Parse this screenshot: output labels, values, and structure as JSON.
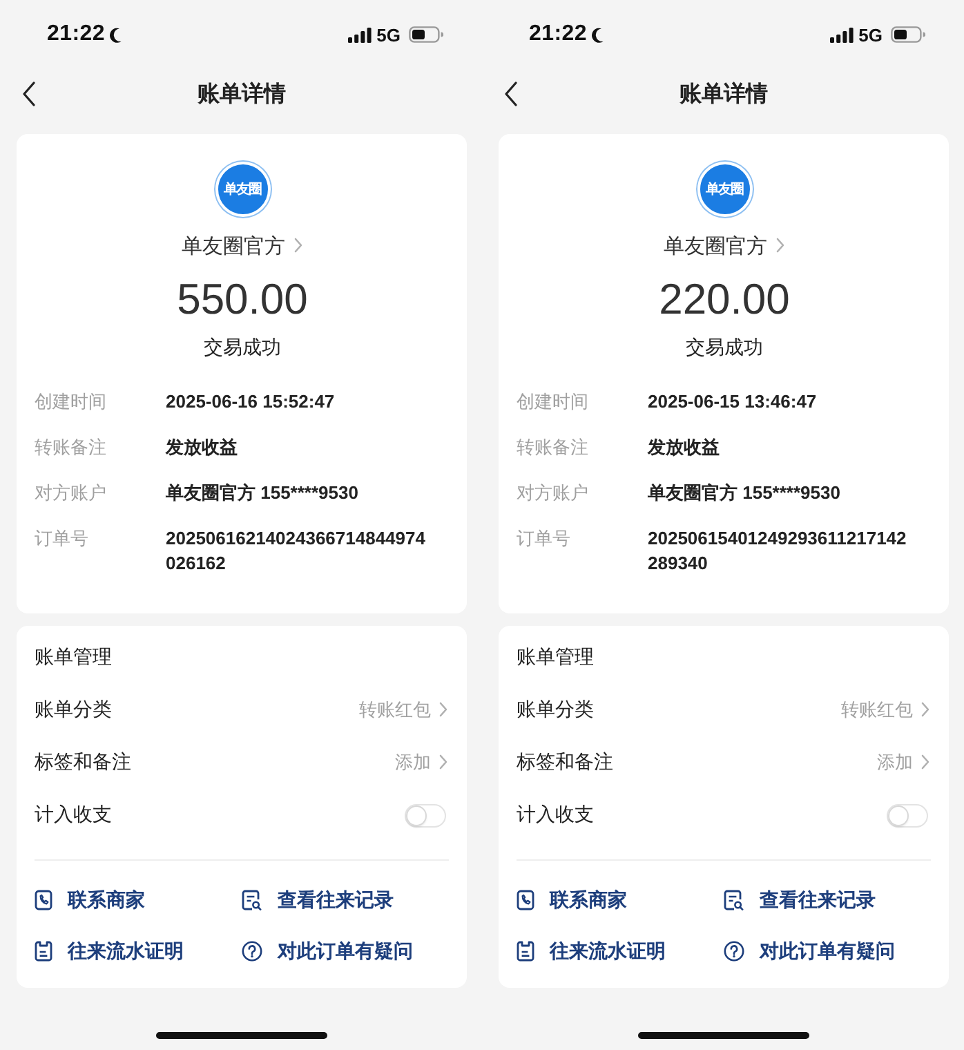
{
  "screens": [
    {
      "status_bar": {
        "time": "21:22",
        "network": "5G"
      },
      "nav": {
        "title": "账单详情"
      },
      "merchant": {
        "logo_text": "单友圈",
        "name": "单友圈官方"
      },
      "amount": "550.00",
      "status": "交易成功",
      "details": [
        {
          "label": "创建时间",
          "value": "2025-06-16 15:52:47"
        },
        {
          "label": "转账备注",
          "value": "发放收益"
        },
        {
          "label": "对方账户",
          "value": "单友圈官方 155****9530"
        },
        {
          "label": "订单号",
          "value": "20250616214024366714844974026162"
        }
      ],
      "management": {
        "title": "账单管理",
        "rows": [
          {
            "kind": "link",
            "label": "账单分类",
            "value": "转账红包"
          },
          {
            "kind": "link",
            "label": "标签和备注",
            "value": "添加"
          },
          {
            "kind": "toggle",
            "label": "计入收支",
            "on": false
          }
        ]
      },
      "actions": [
        "联系商家",
        "查看往来记录",
        "往来流水证明",
        "对此订单有疑问"
      ]
    },
    {
      "status_bar": {
        "time": "21:22",
        "network": "5G"
      },
      "nav": {
        "title": "账单详情"
      },
      "merchant": {
        "logo_text": "单友圈",
        "name": "单友圈官方"
      },
      "amount": "220.00",
      "status": "交易成功",
      "details": [
        {
          "label": "创建时间",
          "value": "2025-06-15 13:46:47"
        },
        {
          "label": "转账备注",
          "value": "发放收益"
        },
        {
          "label": "对方账户",
          "value": "单友圈官方 155****9530"
        },
        {
          "label": "订单号",
          "value": "20250615401249293611217142289340"
        }
      ],
      "management": {
        "title": "账单管理",
        "rows": [
          {
            "kind": "link",
            "label": "账单分类",
            "value": "转账红包"
          },
          {
            "kind": "link",
            "label": "标签和备注",
            "value": "添加"
          },
          {
            "kind": "toggle",
            "label": "计入收支",
            "on": false
          }
        ]
      },
      "actions": [
        "联系商家",
        "查看往来记录",
        "往来流水证明",
        "对此订单有疑问"
      ]
    }
  ]
}
